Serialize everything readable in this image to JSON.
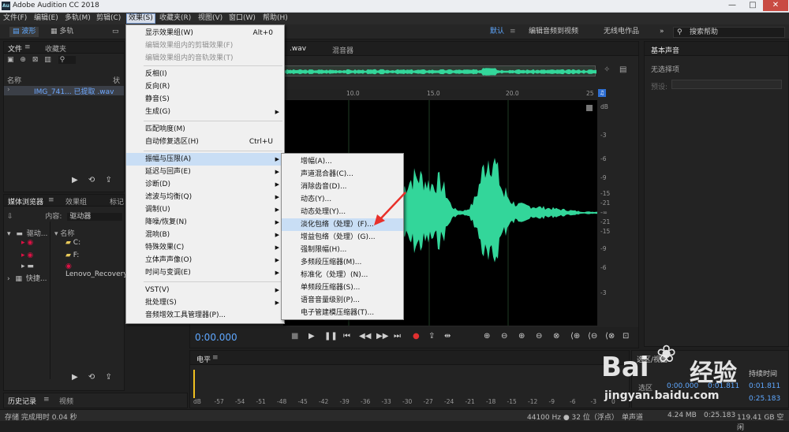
{
  "window": {
    "title": "Adobe Audition CC 2018",
    "controls": {
      "minimize": "—",
      "maximize": "□",
      "close": "✕"
    }
  },
  "menubar": [
    "文件(F)",
    "编辑(E)",
    "多轨(M)",
    "剪辑(C)",
    "效果(S)",
    "收藏夹(R)",
    "视图(V)",
    "窗口(W)",
    "帮助(H)"
  ],
  "toolbar": {
    "waveform": "波形",
    "multitrack": "多轨",
    "workspaces": [
      "默认",
      "编辑音频到视频",
      "无线电作品"
    ],
    "more": "»",
    "search_placeholder": "搜索帮助"
  },
  "files_panel": {
    "tabs": [
      "文件",
      "收藏夹"
    ],
    "col_name": "名称",
    "col_status": "状态",
    "file_name": "IMG_741... 已提取 .wav"
  },
  "media_panel": {
    "tabs": [
      "媒体浏览器",
      "效果组",
      "标记"
    ],
    "content_label": "内容:",
    "content_value": "驱动器",
    "tree_root": "驱动...",
    "tree_shortcut": "快捷...",
    "col_name": "名称",
    "items": [
      "C:",
      "F:",
      "Lenovo_Recovery"
    ]
  },
  "history_panel": {
    "tabs": [
      "历史记录",
      "视频"
    ]
  },
  "editor": {
    "tab_file": ".wav",
    "tab_mixer": "混音器",
    "ruler": [
      "10.0",
      "15.0",
      "20.0",
      "25"
    ],
    "db_labels": [
      "dB",
      "-3",
      "-6",
      "-9",
      "-15",
      "-21",
      "-∞",
      "-21",
      "-15",
      "-9",
      "-6",
      "-3"
    ],
    "time": "0:00.000"
  },
  "level_meter": {
    "title": "电平",
    "scale": [
      "dB",
      "-57",
      "-54",
      "-51",
      "-48",
      "-45",
      "-42",
      "-39",
      "-36",
      "-33",
      "-30",
      "-27",
      "-24",
      "-21",
      "-18",
      "-15",
      "-12",
      "-9",
      "-6",
      "-3",
      "0"
    ]
  },
  "selection_panel": {
    "title": "选区/视图",
    "col_duration": "持续时间",
    "row_label": "选区",
    "v1": "0:00.000",
    "v2": "0:01.811",
    "v3": "0:01.811",
    "v4": "0:25.183"
  },
  "essential_sound": {
    "title": "基本声音",
    "no_selection": "无选择项",
    "preset_label": "预设:"
  },
  "status_bar": {
    "left": "存储 完成用时 0.04 秒",
    "sample_rate": "44100 Hz ● 32 位（浮点）",
    "channels": "单声道",
    "size": "4.24 MB",
    "duration": "0:25.183",
    "free": "119.41 GB 空闲"
  },
  "effects_menu": [
    {
      "label": "显示效果组(W)",
      "shortcut": "Alt+0"
    },
    {
      "label": "编辑效果组内的剪辑效果(F)",
      "disabled": true
    },
    {
      "label": "编辑效果组内的音轨效果(T)",
      "disabled": true
    },
    {
      "label": "反相(I)"
    },
    {
      "label": "反向(R)"
    },
    {
      "label": "静音(S)"
    },
    {
      "label": "生成(G)",
      "submenu": true
    },
    {
      "label": "匹配响度(M)"
    },
    {
      "label": "自动修复选区(H)",
      "shortcut": "Ctrl+U"
    },
    {
      "label": "振幅与压限(A)",
      "submenu": true,
      "hover": true
    },
    {
      "label": "延迟与回声(E)",
      "submenu": true
    },
    {
      "label": "诊断(D)",
      "submenu": true
    },
    {
      "label": "滤波与均衡(Q)",
      "submenu": true
    },
    {
      "label": "调制(U)",
      "submenu": true
    },
    {
      "label": "降噪/恢复(N)",
      "submenu": true
    },
    {
      "label": "混响(B)",
      "submenu": true
    },
    {
      "label": "特殊效果(C)",
      "submenu": true
    },
    {
      "label": "立体声声像(O)",
      "submenu": true
    },
    {
      "label": "时间与变调(E)",
      "submenu": true
    },
    {
      "label": "VST(V)",
      "submenu": true
    },
    {
      "label": "批处理(S)",
      "submenu": true
    },
    {
      "label": "音频增效工具管理器(P)..."
    }
  ],
  "amplitude_submenu": [
    "增幅(A)...",
    "声道混合器(C)...",
    "消除齿音(D)...",
    "动态(Y)...",
    "动态处理(Y)...",
    "淡化包络（处理）(F)...",
    "增益包络（处理）(G)...",
    "强制限幅(H)...",
    "多频段压缩器(M)...",
    "标准化（处理）(N)...",
    "单频段压缩器(S)...",
    "语音音量级别(P)...",
    "电子管建模压缩器(T)..."
  ],
  "watermark": {
    "brand": "Bai",
    "brand2": "经验",
    "url": "jingyan.baidu.com"
  },
  "colors": {
    "waveform": "#33d69a",
    "accent": "#5fa8ff",
    "playhead": "#f0c020",
    "record": "#e03030",
    "arrow": "#e8302a"
  }
}
